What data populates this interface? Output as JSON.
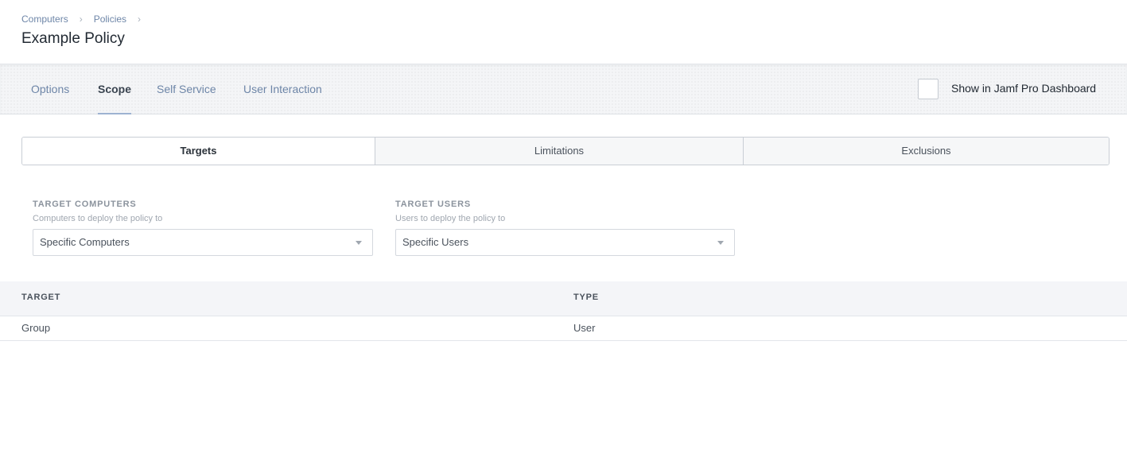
{
  "breadcrumb": {
    "items": [
      "Computers",
      "Policies"
    ],
    "separator": "›"
  },
  "page": {
    "title": "Example Policy"
  },
  "tabs": [
    {
      "label": "Options",
      "active": false
    },
    {
      "label": "Scope",
      "active": true
    },
    {
      "label": "Self Service",
      "active": false
    },
    {
      "label": "User Interaction",
      "active": false
    }
  ],
  "dashboard": {
    "label": "Show in Jamf Pro Dashboard",
    "checked": false
  },
  "scope_tabs": [
    {
      "label": "Targets",
      "active": true
    },
    {
      "label": "Limitations",
      "active": false
    },
    {
      "label": "Exclusions",
      "active": false
    }
  ],
  "target_computers": {
    "label": "TARGET COMPUTERS",
    "help": "Computers to deploy the policy to",
    "value": "Specific Computers"
  },
  "target_users": {
    "label": "TARGET USERS",
    "help": "Users to deploy the policy to",
    "value": "Specific Users"
  },
  "table": {
    "columns": [
      "TARGET",
      "TYPE"
    ],
    "rows": [
      [
        "Group",
        "User"
      ]
    ]
  },
  "colors": {
    "link": "#6e86a8",
    "active_tab_underline": "#9db3d1",
    "text": "#333a42"
  }
}
